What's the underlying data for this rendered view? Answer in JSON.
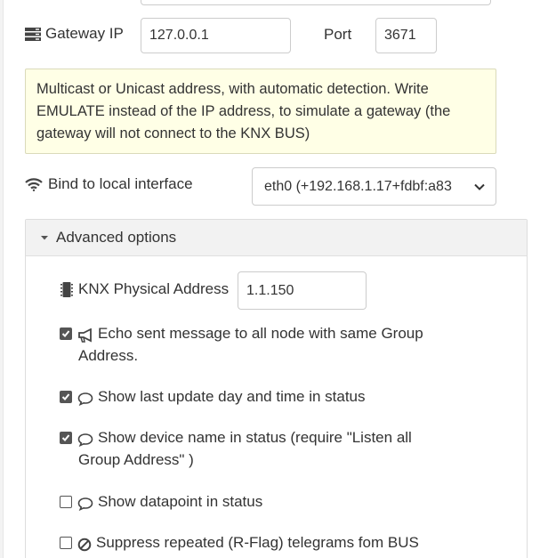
{
  "gateway": {
    "label": "Gateway IP",
    "ip_value": "127.0.0.1",
    "port_label": "Port",
    "port_value": "3671"
  },
  "tip": {
    "text": "Multicast or Unicast address, with automatic detection. Write EMULATE instead of the IP address, to simulate a gateway (the gateway will not connect to the KNX BUS)"
  },
  "bind": {
    "label": "Bind to local interface",
    "selected": "eth0 (+192.168.1.17+fdbf:a83"
  },
  "advanced": {
    "header": "Advanced options",
    "knx_label": "KNX Physical Address",
    "knx_value": "1.1.150",
    "options": [
      {
        "label_line1": "Echo sent message to all node with same Group",
        "label_line2": "Address.",
        "checked": true,
        "icon": "bullhorn-icon"
      },
      {
        "label_line1": "Show last update day and time in status",
        "label_line2": "",
        "checked": true,
        "icon": "comment-icon"
      },
      {
        "label_line1": "Show device name in status (require \"Listen all",
        "label_line2": "Group Address\" )",
        "checked": true,
        "icon": "comment-icon"
      },
      {
        "label_line1": "Show datapoint in status",
        "label_line2": "",
        "checked": false,
        "icon": "comment-icon"
      },
      {
        "label_line1": "Suppress repeated (R-Flag) telegrams fom BUS",
        "label_line2": "",
        "checked": false,
        "icon": "ban-icon"
      }
    ]
  }
}
